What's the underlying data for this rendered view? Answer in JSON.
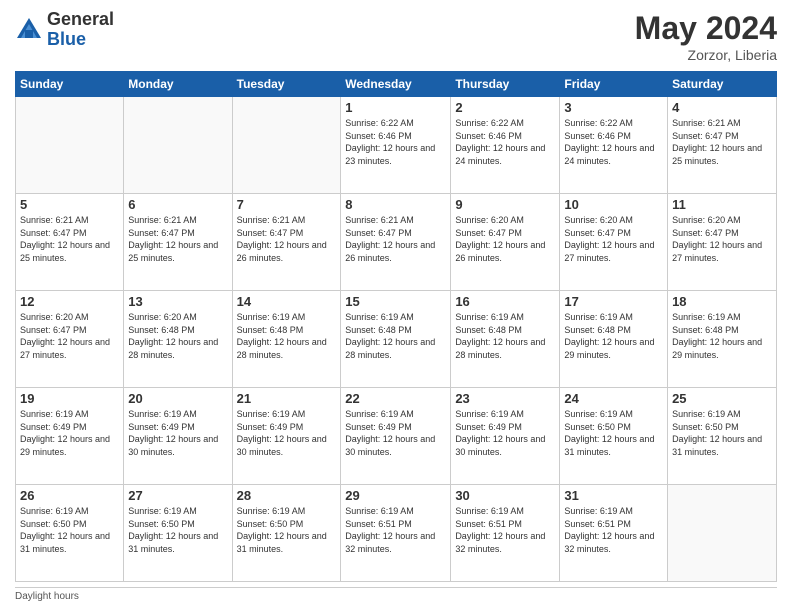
{
  "header": {
    "logo_general": "General",
    "logo_blue": "Blue",
    "month_year": "May 2024",
    "location": "Zorzor, Liberia"
  },
  "days_of_week": [
    "Sunday",
    "Monday",
    "Tuesday",
    "Wednesday",
    "Thursday",
    "Friday",
    "Saturday"
  ],
  "weeks": [
    [
      {
        "day": "",
        "info": ""
      },
      {
        "day": "",
        "info": ""
      },
      {
        "day": "",
        "info": ""
      },
      {
        "day": "1",
        "info": "Sunrise: 6:22 AM\nSunset: 6:46 PM\nDaylight: 12 hours\nand 23 minutes."
      },
      {
        "day": "2",
        "info": "Sunrise: 6:22 AM\nSunset: 6:46 PM\nDaylight: 12 hours\nand 24 minutes."
      },
      {
        "day": "3",
        "info": "Sunrise: 6:22 AM\nSunset: 6:46 PM\nDaylight: 12 hours\nand 24 minutes."
      },
      {
        "day": "4",
        "info": "Sunrise: 6:21 AM\nSunset: 6:47 PM\nDaylight: 12 hours\nand 25 minutes."
      }
    ],
    [
      {
        "day": "5",
        "info": "Sunrise: 6:21 AM\nSunset: 6:47 PM\nDaylight: 12 hours\nand 25 minutes."
      },
      {
        "day": "6",
        "info": "Sunrise: 6:21 AM\nSunset: 6:47 PM\nDaylight: 12 hours\nand 25 minutes."
      },
      {
        "day": "7",
        "info": "Sunrise: 6:21 AM\nSunset: 6:47 PM\nDaylight: 12 hours\nand 26 minutes."
      },
      {
        "day": "8",
        "info": "Sunrise: 6:21 AM\nSunset: 6:47 PM\nDaylight: 12 hours\nand 26 minutes."
      },
      {
        "day": "9",
        "info": "Sunrise: 6:20 AM\nSunset: 6:47 PM\nDaylight: 12 hours\nand 26 minutes."
      },
      {
        "day": "10",
        "info": "Sunrise: 6:20 AM\nSunset: 6:47 PM\nDaylight: 12 hours\nand 27 minutes."
      },
      {
        "day": "11",
        "info": "Sunrise: 6:20 AM\nSunset: 6:47 PM\nDaylight: 12 hours\nand 27 minutes."
      }
    ],
    [
      {
        "day": "12",
        "info": "Sunrise: 6:20 AM\nSunset: 6:47 PM\nDaylight: 12 hours\nand 27 minutes."
      },
      {
        "day": "13",
        "info": "Sunrise: 6:20 AM\nSunset: 6:48 PM\nDaylight: 12 hours\nand 28 minutes."
      },
      {
        "day": "14",
        "info": "Sunrise: 6:19 AM\nSunset: 6:48 PM\nDaylight: 12 hours\nand 28 minutes."
      },
      {
        "day": "15",
        "info": "Sunrise: 6:19 AM\nSunset: 6:48 PM\nDaylight: 12 hours\nand 28 minutes."
      },
      {
        "day": "16",
        "info": "Sunrise: 6:19 AM\nSunset: 6:48 PM\nDaylight: 12 hours\nand 28 minutes."
      },
      {
        "day": "17",
        "info": "Sunrise: 6:19 AM\nSunset: 6:48 PM\nDaylight: 12 hours\nand 29 minutes."
      },
      {
        "day": "18",
        "info": "Sunrise: 6:19 AM\nSunset: 6:48 PM\nDaylight: 12 hours\nand 29 minutes."
      }
    ],
    [
      {
        "day": "19",
        "info": "Sunrise: 6:19 AM\nSunset: 6:49 PM\nDaylight: 12 hours\nand 29 minutes."
      },
      {
        "day": "20",
        "info": "Sunrise: 6:19 AM\nSunset: 6:49 PM\nDaylight: 12 hours\nand 30 minutes."
      },
      {
        "day": "21",
        "info": "Sunrise: 6:19 AM\nSunset: 6:49 PM\nDaylight: 12 hours\nand 30 minutes."
      },
      {
        "day": "22",
        "info": "Sunrise: 6:19 AM\nSunset: 6:49 PM\nDaylight: 12 hours\nand 30 minutes."
      },
      {
        "day": "23",
        "info": "Sunrise: 6:19 AM\nSunset: 6:49 PM\nDaylight: 12 hours\nand 30 minutes."
      },
      {
        "day": "24",
        "info": "Sunrise: 6:19 AM\nSunset: 6:50 PM\nDaylight: 12 hours\nand 31 minutes."
      },
      {
        "day": "25",
        "info": "Sunrise: 6:19 AM\nSunset: 6:50 PM\nDaylight: 12 hours\nand 31 minutes."
      }
    ],
    [
      {
        "day": "26",
        "info": "Sunrise: 6:19 AM\nSunset: 6:50 PM\nDaylight: 12 hours\nand 31 minutes."
      },
      {
        "day": "27",
        "info": "Sunrise: 6:19 AM\nSunset: 6:50 PM\nDaylight: 12 hours\nand 31 minutes."
      },
      {
        "day": "28",
        "info": "Sunrise: 6:19 AM\nSunset: 6:50 PM\nDaylight: 12 hours\nand 31 minutes."
      },
      {
        "day": "29",
        "info": "Sunrise: 6:19 AM\nSunset: 6:51 PM\nDaylight: 12 hours\nand 32 minutes."
      },
      {
        "day": "30",
        "info": "Sunrise: 6:19 AM\nSunset: 6:51 PM\nDaylight: 12 hours\nand 32 minutes."
      },
      {
        "day": "31",
        "info": "Sunrise: 6:19 AM\nSunset: 6:51 PM\nDaylight: 12 hours\nand 32 minutes."
      },
      {
        "day": "",
        "info": ""
      }
    ]
  ],
  "footer": {
    "daylight_hours_label": "Daylight hours"
  }
}
